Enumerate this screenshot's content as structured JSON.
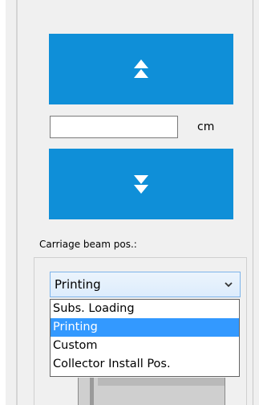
{
  "move": {
    "up_icon": "double-chevron-up-icon",
    "down_icon": "double-chevron-down-icon",
    "color": "#0f8fd8"
  },
  "distance": {
    "value": "",
    "unit": "cm"
  },
  "carriage": {
    "label": "Carriage beam pos.:",
    "selected": "Printing",
    "options": [
      "Subs. Loading",
      "Printing",
      "Custom",
      "Collector Install Pos."
    ],
    "selected_index": 1,
    "highlight_color": "#3399ff"
  }
}
